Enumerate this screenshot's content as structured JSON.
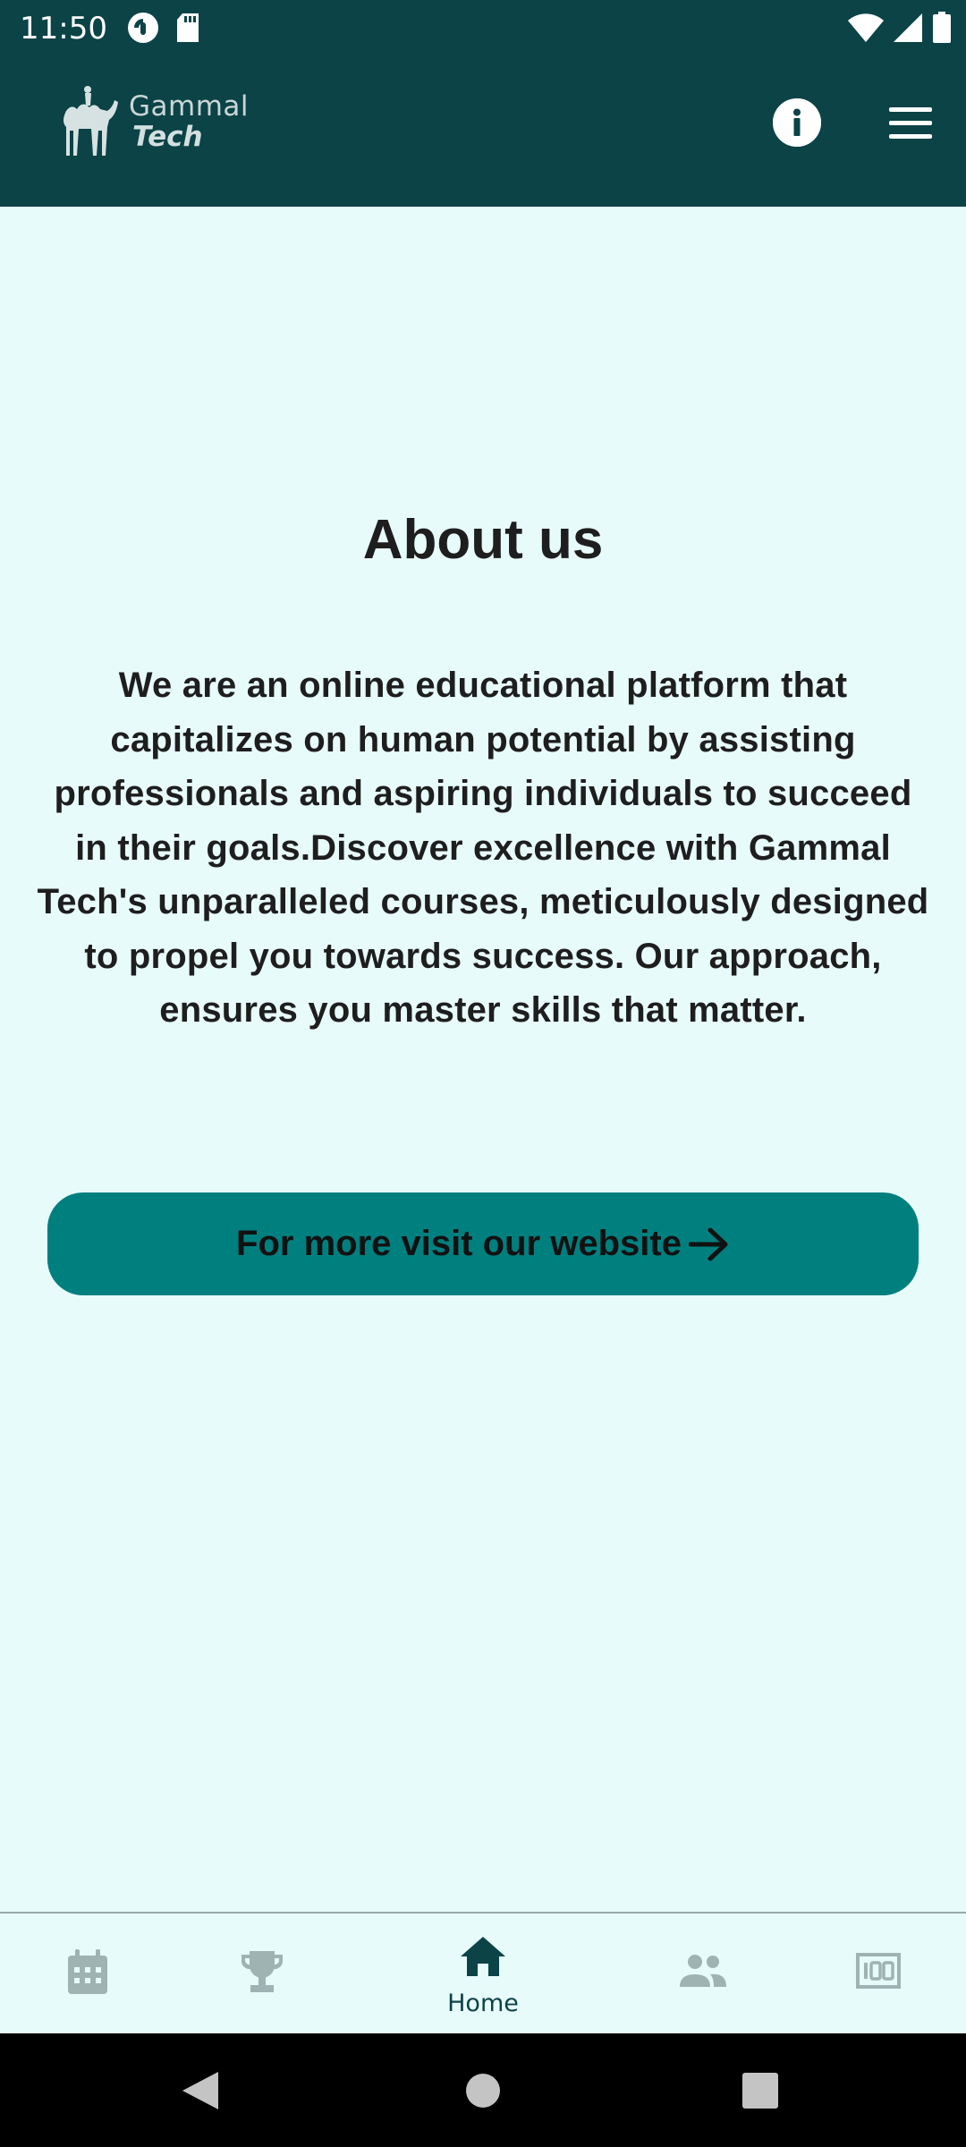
{
  "status_bar": {
    "time": "11:50",
    "left_icons": [
      "pocket-casts-icon",
      "sd-card-icon"
    ],
    "right_icons": [
      "wifi-icon",
      "signal-icon",
      "battery-icon"
    ]
  },
  "header": {
    "logo_line1": "Gammal",
    "logo_line2": "Tech",
    "logo_icon": "camel-rider-icon",
    "info_icon": "info-icon",
    "menu_icon": "hamburger-menu-icon",
    "background": "#0b4347"
  },
  "about": {
    "title": "About us",
    "body": "We are an online educational platform that capitalizes on human potential by assisting professionals and aspiring individuals to succeed in their goals.Discover excellence with Gammal Tech's unparalleled courses, meticulously designed to propel you towards success. Our approach, ensures you master skills that matter."
  },
  "cta": {
    "label": "For more visit our website",
    "icon": "arrow-right-icon",
    "color": "#007f7f"
  },
  "bottom_nav": {
    "items": [
      {
        "icon": "calendar-icon",
        "active": false
      },
      {
        "icon": "trophy-icon",
        "active": false
      },
      {
        "icon": "home-icon",
        "label": "Home",
        "active": true
      },
      {
        "icon": "people-icon",
        "active": false
      },
      {
        "icon": "score-100-icon",
        "active": false
      }
    ]
  },
  "system_nav": {
    "items": [
      "back-icon",
      "home-circle-icon",
      "recents-icon"
    ]
  }
}
